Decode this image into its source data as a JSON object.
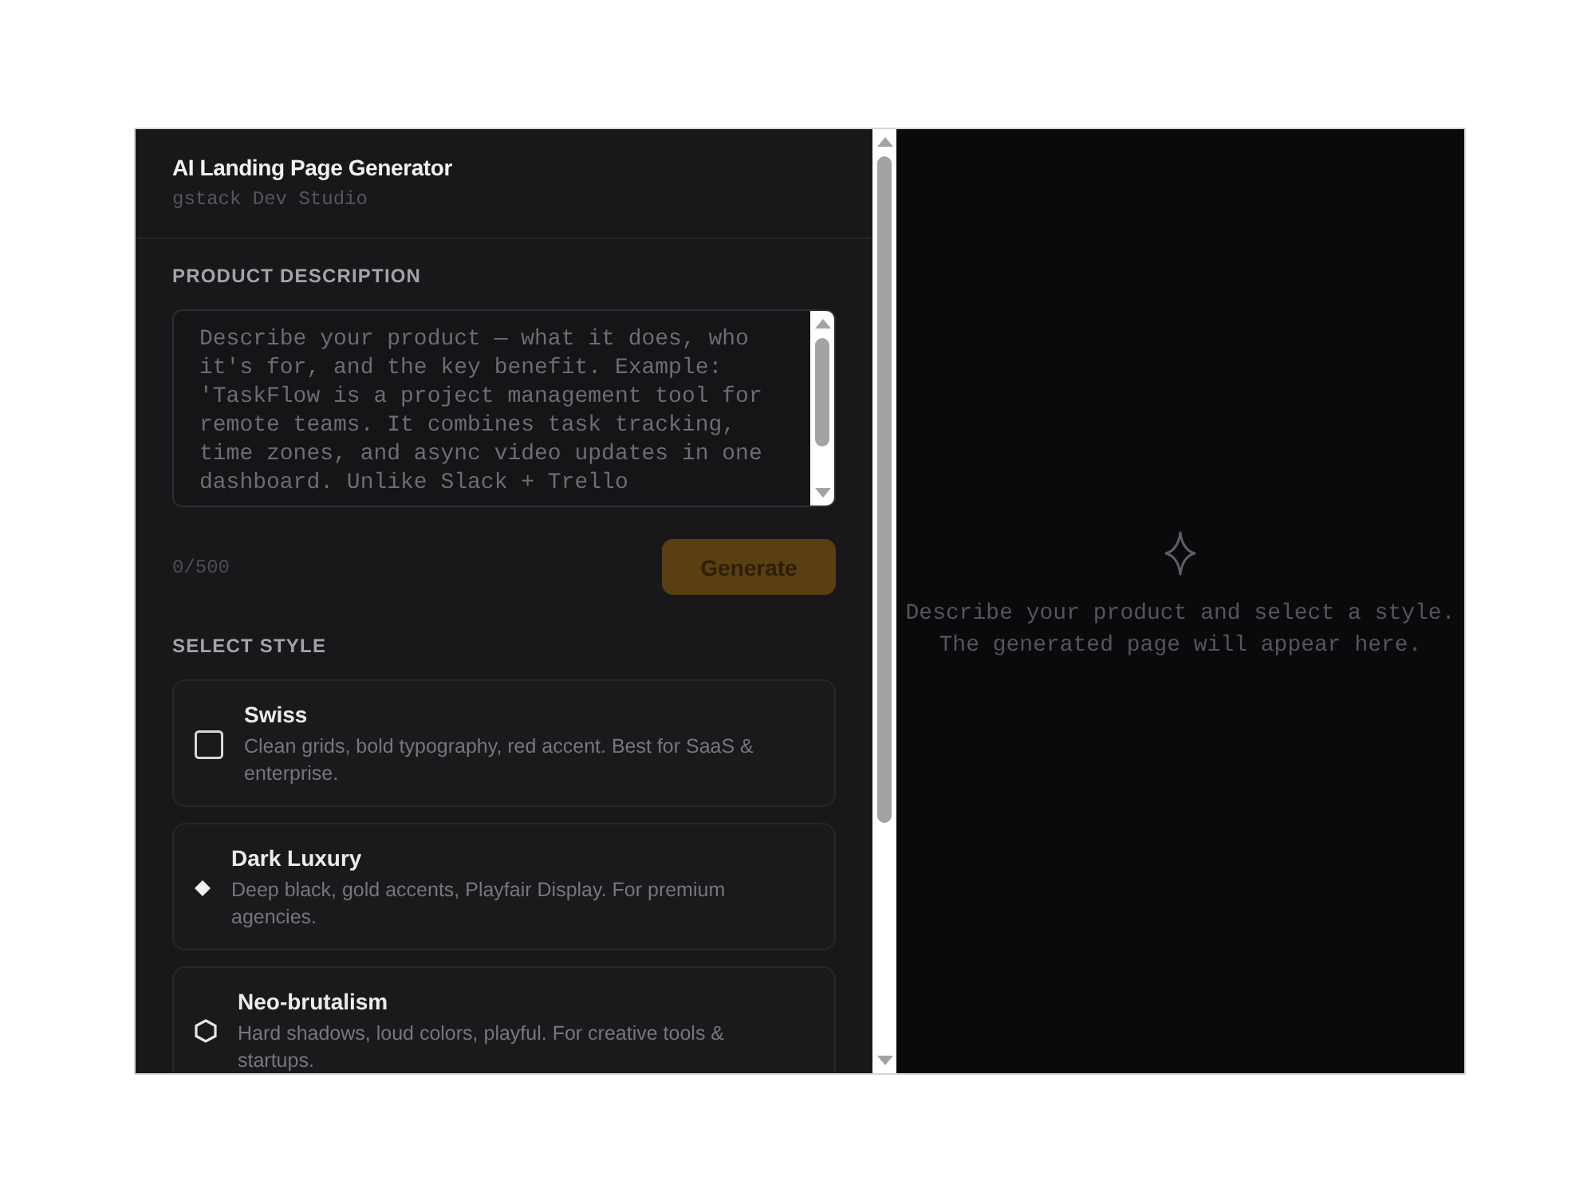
{
  "header": {
    "title": "AI Landing Page Generator",
    "subtitle": "gstack Dev Studio"
  },
  "description": {
    "label": "PRODUCT DESCRIPTION",
    "placeholder": "Describe your product — what it does, who it's for, and the key benefit. Example: 'TaskFlow is a project management tool for remote teams. It combines task tracking, time zones, and async video updates in one dashboard. Unlike Slack + Trello",
    "counter": "0/500",
    "generate_button": {
      "label": "Generate",
      "disabled": true
    }
  },
  "styles": {
    "label": "SELECT STYLE",
    "options": [
      {
        "kind": "swiss",
        "name": "Swiss",
        "description": "Clean grids, bold typography, red accent. Best for SaaS & enterprise.",
        "selected": false
      },
      {
        "kind": "luxury",
        "name": "Dark Luxury",
        "description": "Deep black, gold accents, Playfair Display. For premium agencies.",
        "selected": false
      },
      {
        "kind": "brutalist",
        "name": "Neo-brutalism",
        "description": "Hard shadows, loud colors, playful. For creative tools & startups.",
        "selected": false
      }
    ]
  },
  "preview": {
    "message": "Describe your product and select a style. The generated page will appear here."
  }
}
